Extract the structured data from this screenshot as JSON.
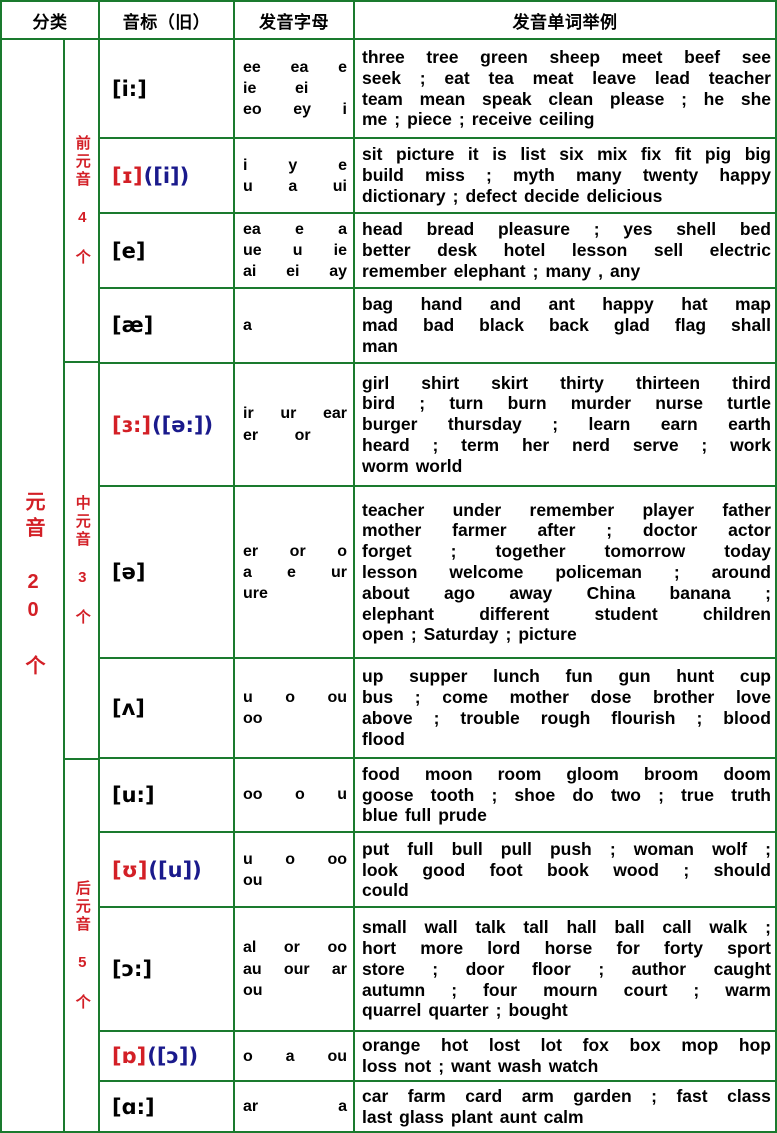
{
  "header": {
    "columns": [
      {
        "label": "分类",
        "name": "category"
      },
      {
        "label": "音标（旧）",
        "name": "phonetic-symbol-old"
      },
      {
        "label": "发音字母",
        "name": "spelling-letters"
      },
      {
        "label": "发音单词举例",
        "name": "example-words"
      }
    ]
  },
  "colors": {
    "grid": "#1a7a2e",
    "red": "#d31f26",
    "blue": "#1a1a8c",
    "text": "#000000"
  },
  "vowel_column": {
    "label": "元音 20 个"
  },
  "groups": [
    {
      "label": "前元音 4 个",
      "rows": 4
    },
    {
      "label": "中元音 3 个",
      "rows": 3
    },
    {
      "label": "后元音 5 个",
      "rows": 5
    }
  ],
  "rows": [
    {
      "name": "row-i-long",
      "ipa_main": "[i:]",
      "ipa_alt": "",
      "ipa_colored": false,
      "letters": [
        [
          "ee",
          "ea",
          "e"
        ],
        [
          "ie",
          "ei",
          ""
        ],
        [
          "eo",
          "ey",
          "i"
        ]
      ],
      "words": [
        "three tree green sheep meet beef see",
        "seek ; eat tea meat leave lead teacher",
        "team mean speak clean please ; he she",
        "me ; piece ; receive ceiling"
      ]
    },
    {
      "name": "row-small-i",
      "ipa_main": "[ɪ]",
      "ipa_alt": "([i])",
      "ipa_colored": true,
      "letters": [
        [
          "i",
          "y",
          "e"
        ],
        [
          "u",
          "a",
          "ui"
        ]
      ],
      "words": [
        "sit picture it is list six mix fix fit pig big",
        "build miss ; myth many twenty happy",
        "dictionary ; defect decide delicious"
      ]
    },
    {
      "name": "row-e",
      "ipa_main": "[e]",
      "ipa_alt": "",
      "ipa_colored": false,
      "letters": [
        [
          "ea",
          "e",
          "a"
        ],
        [
          "ue",
          "u",
          "ie"
        ],
        [
          "ai",
          "ei",
          "ay"
        ]
      ],
      "words": [
        "head bread pleasure ; yes shell bed",
        "better desk hotel lesson sell electric",
        "remember elephant ; many , any"
      ]
    },
    {
      "name": "row-ae",
      "ipa_main": "[æ]",
      "ipa_alt": "",
      "ipa_colored": false,
      "letters": [
        [
          "a"
        ]
      ],
      "words": [
        "bag hand and ant happy hat map",
        "mad bad black back glad flag shall",
        "man"
      ]
    },
    {
      "name": "row-er-long",
      "ipa_main": "[ɜ:]",
      "ipa_alt": "([ə:])",
      "ipa_colored": true,
      "letters": [
        [
          "ir",
          "ur",
          "ear"
        ],
        [
          "er",
          "or",
          ""
        ]
      ],
      "words": [
        "girl shirt skirt thirty thirteen third",
        "bird ; turn burn murder nurse turtle",
        "burger thursday ; learn earn earth",
        "heard ; term her nerd serve ; work",
        "worm world"
      ]
    },
    {
      "name": "row-schwa",
      "ipa_main": "[ə]",
      "ipa_alt": "",
      "ipa_colored": false,
      "letters": [
        [
          "er",
          "or",
          "o"
        ],
        [
          "a",
          "e",
          "ur"
        ],
        [
          "ure",
          "",
          ""
        ]
      ],
      "words": [
        "teacher under remember player father",
        "mother farmer after ; doctor actor",
        "forget ; together tomorrow today",
        "lesson welcome policeman ; around",
        "about ago away China banana ;",
        "elephant different student children",
        "open ; Saturday ; picture"
      ]
    },
    {
      "name": "row-caret",
      "ipa_main": "[ʌ]",
      "ipa_alt": "",
      "ipa_colored": false,
      "letters": [
        [
          "u",
          "o",
          "ou"
        ],
        [
          "oo",
          "",
          ""
        ]
      ],
      "words": [
        "up supper lunch fun gun hunt cup",
        "bus ; come mother dose brother love",
        "above ; trouble rough flourish ; blood",
        "flood"
      ]
    },
    {
      "name": "row-u-long",
      "ipa_main": "[u:]",
      "ipa_alt": "",
      "ipa_colored": false,
      "letters": [
        [
          "oo",
          "o",
          "u"
        ]
      ],
      "words": [
        "food moon room gloom broom doom",
        "goose tooth ; shoe do two ; true truth",
        "blue full prude"
      ]
    },
    {
      "name": "row-small-u",
      "ipa_main": "[ʊ]",
      "ipa_alt": "([u])",
      "ipa_colored": true,
      "letters": [
        [
          "u",
          "o",
          "oo"
        ],
        [
          "ou",
          "",
          ""
        ]
      ],
      "words": [
        "put full bull pull push ; woman   wolf ;",
        "look good foot book wood ; should",
        "could"
      ]
    },
    {
      "name": "row-open-o-long",
      "ipa_main": "[ɔ:]",
      "ipa_alt": "",
      "ipa_colored": false,
      "letters": [
        [
          "al",
          "or",
          "oo"
        ],
        [
          "au",
          "our",
          "ar"
        ],
        [
          "ou",
          "",
          ""
        ]
      ],
      "words": [
        "small wall talk tall hall ball call walk ;",
        "hort more lord horse for forty sport",
        "store ; door floor ; author   caught",
        "autumn ; four mourn court ; warm",
        "quarrel quarter ; bought"
      ]
    },
    {
      "name": "row-open-o-short",
      "ipa_main": "[ɒ]",
      "ipa_alt": "([ɔ])",
      "ipa_colored": true,
      "letters": [
        [
          "o",
          "a",
          "ou"
        ]
      ],
      "words": [
        "orange hot lost lot fox box mop hop",
        "loss not ; want wash watch"
      ]
    },
    {
      "name": "row-a-long",
      "ipa_main": "[ɑ:]",
      "ipa_alt": "",
      "ipa_colored": false,
      "letters": [
        [
          "ar",
          "a"
        ]
      ],
      "words": [
        "car farm card arm garden ; fast class",
        "last glass plant aunt calm"
      ]
    }
  ]
}
